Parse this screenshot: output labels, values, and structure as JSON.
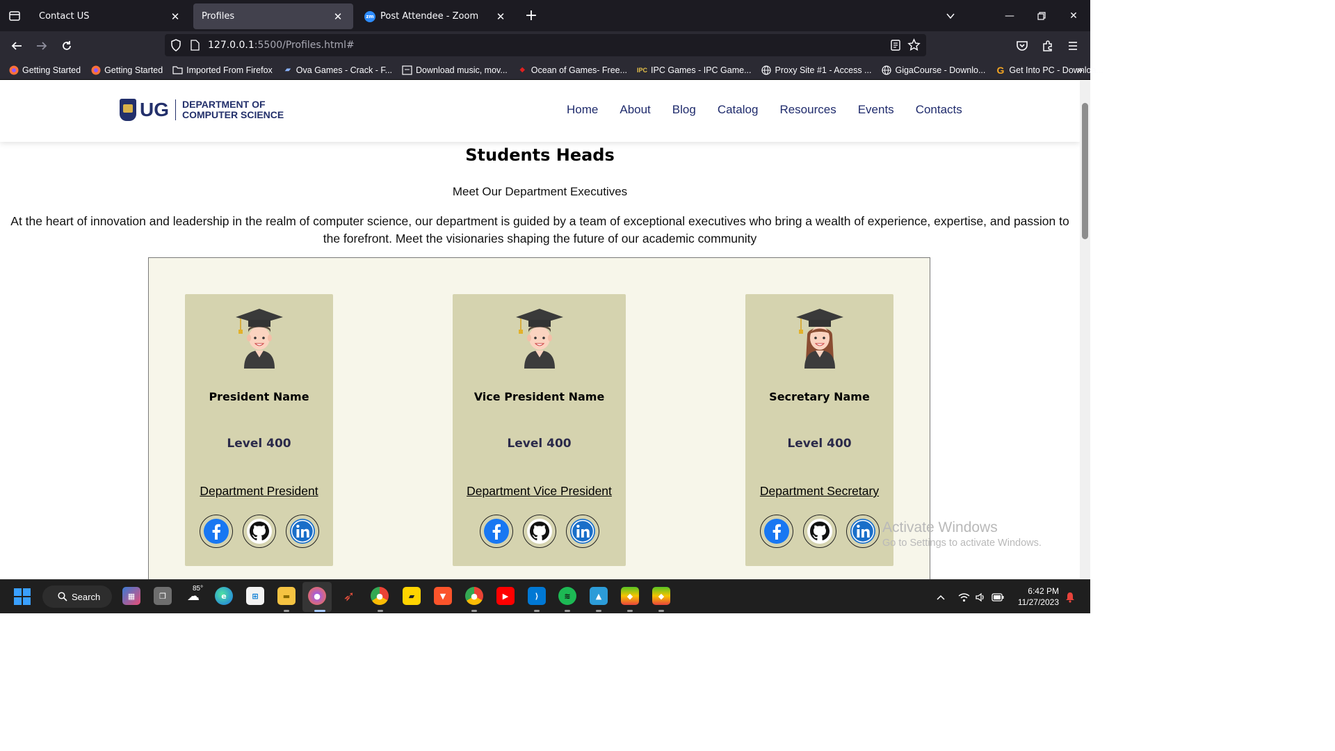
{
  "browser": {
    "tabs": [
      {
        "label": "Contact US"
      },
      {
        "label": "Profiles"
      },
      {
        "label": "Post Attendee - Zoom"
      }
    ],
    "url": {
      "host": "127.0.0.1",
      "path": ":5500/Profiles.html#"
    },
    "bookmarks": [
      {
        "label": "Getting Started",
        "icon": "firefox-icon"
      },
      {
        "label": "Getting Started",
        "icon": "firefox-icon"
      },
      {
        "label": "Imported From Firefox",
        "icon": "folder-icon"
      },
      {
        "label": "Ova Games - Crack - F...",
        "icon": "ova-icon"
      },
      {
        "label": "Download music, mov...",
        "icon": "download-icon"
      },
      {
        "label": "Ocean of Games- Free...",
        "icon": "ocean-icon"
      },
      {
        "label": "IPC Games - IPC Game...",
        "icon": "ipc-icon"
      },
      {
        "label": "Proxy Site #1 - Access ...",
        "icon": "globe-icon"
      },
      {
        "label": "GigaCourse - Downlo...",
        "icon": "globe-icon"
      },
      {
        "label": "Get Into PC - Downloa...",
        "icon": "g-icon"
      }
    ]
  },
  "site": {
    "logo": {
      "short": "UG",
      "line1": "DEPARTMENT OF",
      "line2": "COMPUTER SCIENCE"
    },
    "nav": [
      "Home",
      "About",
      "Blog",
      "Catalog",
      "Resources",
      "Events",
      "Contacts"
    ],
    "title": "Students Heads",
    "subtitle": "Meet Our Department Executives",
    "intro": "At the heart of innovation and leadership in the realm of computer science, our department is guided by a team of exceptional executives who bring a wealth of experience, expertise, and passion to the forefront. Meet the visionaries shaping the future of our academic community",
    "cards": [
      {
        "name": "President Name",
        "level": "Level 400",
        "role": "Department President",
        "avatar": "male-graduate-icon"
      },
      {
        "name": "Vice President Name",
        "level": "Level 400",
        "role": "Department Vice President",
        "avatar": "male-graduate-icon"
      },
      {
        "name": "Secretary Name",
        "level": "Level 400",
        "role": "Department Secretary",
        "avatar": "female-graduate-icon"
      }
    ],
    "colors": {
      "panel": "#f7f6ea",
      "card": "#d5d3af",
      "brand": "#23306b",
      "nav": "#1f2b6c"
    }
  },
  "watermark": {
    "line1": "Activate Windows",
    "line2": "Go to Settings to activate Windows."
  },
  "taskbar": {
    "search_label": "Search",
    "weather": "85°",
    "time": "6:42 PM",
    "date": "11/27/2023"
  }
}
